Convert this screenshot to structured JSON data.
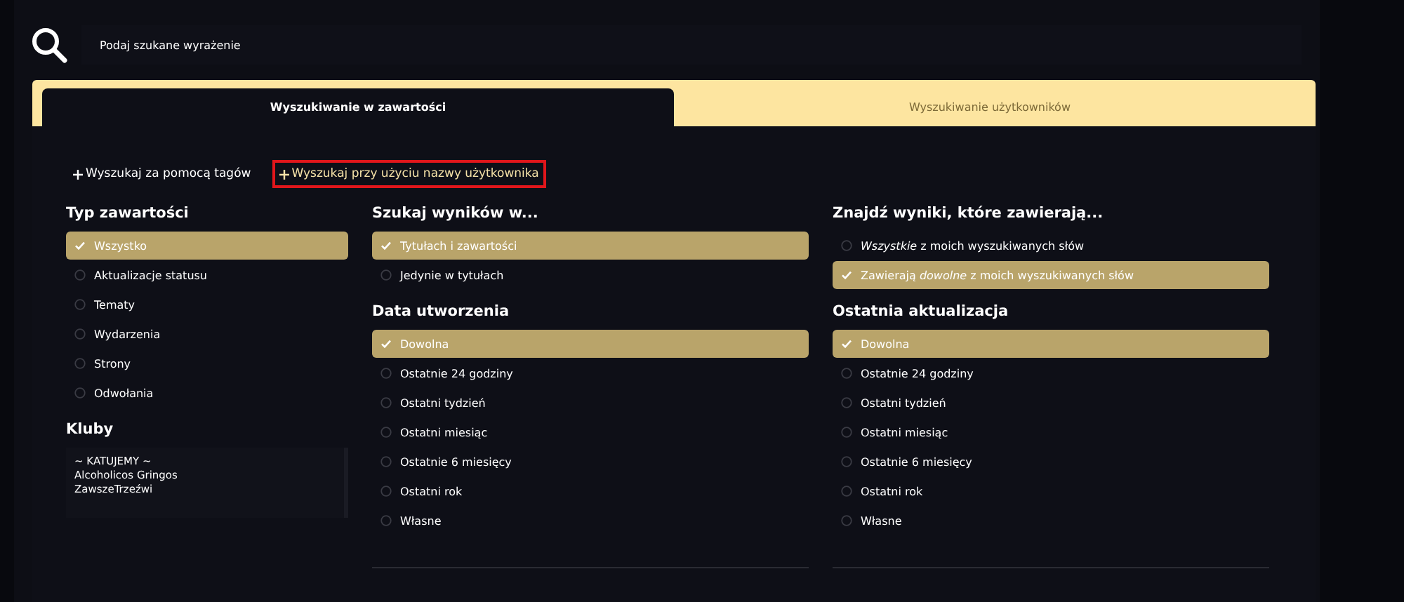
{
  "search": {
    "placeholder": "Podaj szukane wyrażenie"
  },
  "tabs": [
    {
      "label": "Wyszukiwanie w zawartości",
      "selected": true
    },
    {
      "label": "Wyszukiwanie użytkowników",
      "selected": false
    }
  ],
  "links": [
    {
      "label": "Wyszukaj za pomocą tagów",
      "outlined": false
    },
    {
      "label": "Wyszukaj przy użyciu nazwy użytkownika",
      "outlined": true
    }
  ],
  "columns": [
    [
      {
        "kind": "options",
        "title": "Typ zawartości",
        "options": [
          {
            "label": "Wszystko",
            "selected": true
          },
          {
            "label": "Aktualizacje statusu",
            "selected": false
          },
          {
            "label": "Tematy",
            "selected": false
          },
          {
            "label": "Wydarzenia",
            "selected": false
          },
          {
            "label": "Strony",
            "selected": false
          },
          {
            "label": "Odwołania",
            "selected": false
          }
        ]
      },
      {
        "kind": "list",
        "title": "Kluby",
        "items": [
          "~ KATUJEMY ~",
          "Alcoholicos Gringos",
          "ZawszeTrzeźwi"
        ]
      }
    ],
    [
      {
        "kind": "options",
        "title": "Szukaj wyników w...",
        "options": [
          {
            "label": "Tytułach i zawartości",
            "selected": true
          },
          {
            "label": "Jedynie w tytułach",
            "selected": false
          }
        ]
      },
      {
        "kind": "options",
        "title": "Data utworzenia",
        "options": [
          {
            "label": "Dowolna",
            "selected": true
          },
          {
            "label": "Ostatnie 24 godziny",
            "selected": false
          },
          {
            "label": "Ostatni tydzień",
            "selected": false
          },
          {
            "label": "Ostatni miesiąc",
            "selected": false
          },
          {
            "label": "Ostatnie 6 miesięcy",
            "selected": false
          },
          {
            "label": "Ostatni rok",
            "selected": false
          },
          {
            "label": "Własne",
            "selected": false
          }
        ]
      }
    ],
    [
      {
        "kind": "options",
        "title": "Znajdź wyniki, które zawierają...",
        "options": [
          {
            "label": "*Wszystkie* z moich wyszukiwanych słów",
            "selected": false
          },
          {
            "label": "Zawierają *dowolne* z moich wyszukiwanych słów",
            "selected": true
          }
        ]
      },
      {
        "kind": "options",
        "title": "Ostatnia aktualizacja",
        "options": [
          {
            "label": "Dowolna",
            "selected": true
          },
          {
            "label": "Ostatnie 24 godziny",
            "selected": false
          },
          {
            "label": "Ostatni tydzień",
            "selected": false
          },
          {
            "label": "Ostatni miesiąc",
            "selected": false
          },
          {
            "label": "Ostatnie 6 miesięcy",
            "selected": false
          },
          {
            "label": "Ostatni rok",
            "selected": false
          },
          {
            "label": "Własne",
            "selected": false
          }
        ]
      }
    ]
  ]
}
